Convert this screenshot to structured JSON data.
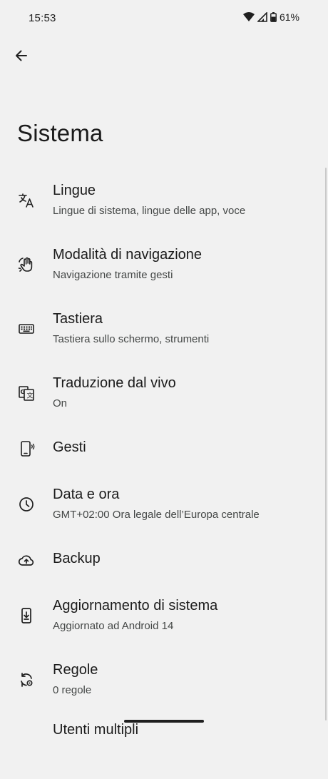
{
  "status_bar": {
    "time": "15:53",
    "battery": "61%",
    "icons": [
      "wifi-icon",
      "signal-icon",
      "battery-icon"
    ]
  },
  "header": {
    "back_icon": "arrow-back-icon",
    "title": "Sistema"
  },
  "items": [
    {
      "title": "Lingue",
      "subtitle": "Lingue di sistema, lingue delle app, voce",
      "icon": "translate-icon"
    },
    {
      "title": "Modalità di navigazione",
      "subtitle": "Navigazione tramite gesti",
      "icon": "gesture-hand-icon"
    },
    {
      "title": "Tastiera",
      "subtitle": "Tastiera sullo schermo, strumenti",
      "icon": "keyboard-icon"
    },
    {
      "title": "Traduzione dal vivo",
      "subtitle": "On",
      "icon": "live-translate-icon"
    },
    {
      "title": "Gesti",
      "subtitle": "",
      "icon": "phone-gesture-icon"
    },
    {
      "title": "Data e ora",
      "subtitle": "GMT+02:00 Ora legale dell’Europa centrale",
      "icon": "clock-icon"
    },
    {
      "title": "Backup",
      "subtitle": "",
      "icon": "cloud-upload-icon"
    },
    {
      "title": "Aggiornamento di sistema",
      "subtitle": "Aggiornato ad Android 14",
      "icon": "system-update-icon"
    },
    {
      "title": "Regole",
      "subtitle": "0 regole",
      "icon": "rules-icon"
    },
    {
      "title": "Utenti multipli",
      "subtitle": "",
      "icon": "users-icon"
    }
  ],
  "colors": {
    "background": "#f1f1f1",
    "text_primary": "#1b1b1b",
    "text_secondary": "#444746"
  }
}
